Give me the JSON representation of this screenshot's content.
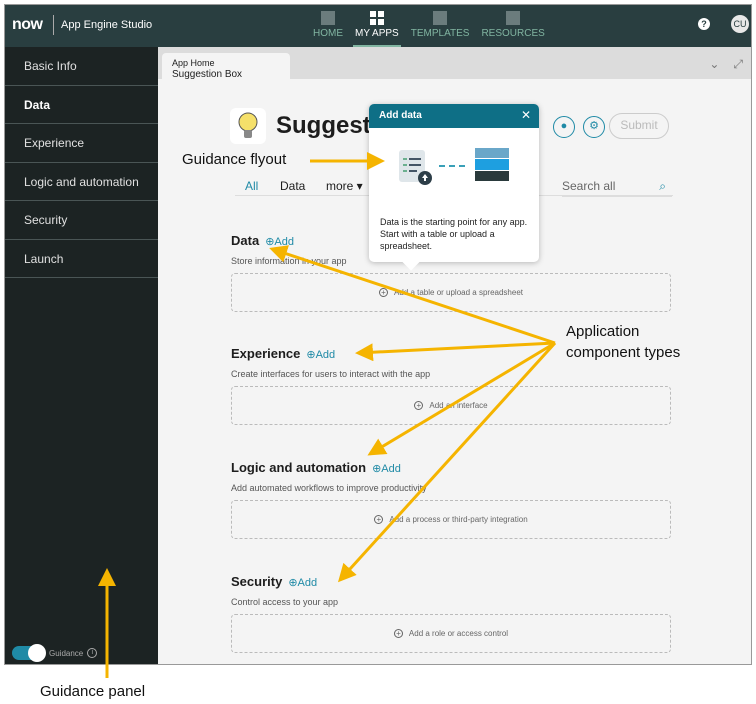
{
  "header": {
    "logo": "now",
    "app_name": "App Engine Studio",
    "nav": [
      "HOME",
      "MY APPS",
      "TEMPLATES",
      "RESOURCES"
    ],
    "help": "?",
    "avatar": "CU"
  },
  "sidebar": {
    "items": [
      "Basic Info",
      "Data",
      "Experience",
      "Logic and automation",
      "Security",
      "Launch"
    ],
    "guidance": "Guidance",
    "info": "i"
  },
  "tab": {
    "line1": "App Home",
    "line2": "Suggestion Box"
  },
  "app": {
    "title": "Suggestion Box",
    "submit": "Submit"
  },
  "filters": {
    "all": "All",
    "data": "Data",
    "more": "more ▾",
    "search_placeholder": "Search all"
  },
  "sections": [
    {
      "title": "Data",
      "add": "Add",
      "desc": "Store information in your app",
      "box": "Add a table or upload a spreadsheet"
    },
    {
      "title": "Experience",
      "add": "Add",
      "desc": "Create interfaces for users to interact with the app",
      "box": "Add an interface"
    },
    {
      "title": "Logic and automation",
      "add": "Add",
      "desc": "Add automated workflows to improve productivity",
      "box": "Add a process or third-party integration"
    },
    {
      "title": "Security",
      "add": "Add",
      "desc": "Control access to your app",
      "box": "Add a role or access control"
    }
  ],
  "flyout": {
    "title": "Add data",
    "text": "Data is the starting point for any app. Start with a table or upload a spreadsheet."
  },
  "annotations": {
    "flyout": "Guidance flyout",
    "components1": "Application",
    "components2": "component types",
    "panel": "Guidance panel"
  },
  "colors": {
    "accent": "#1f8aa6",
    "arrow": "#f5b400",
    "topbar": "#293e40"
  }
}
